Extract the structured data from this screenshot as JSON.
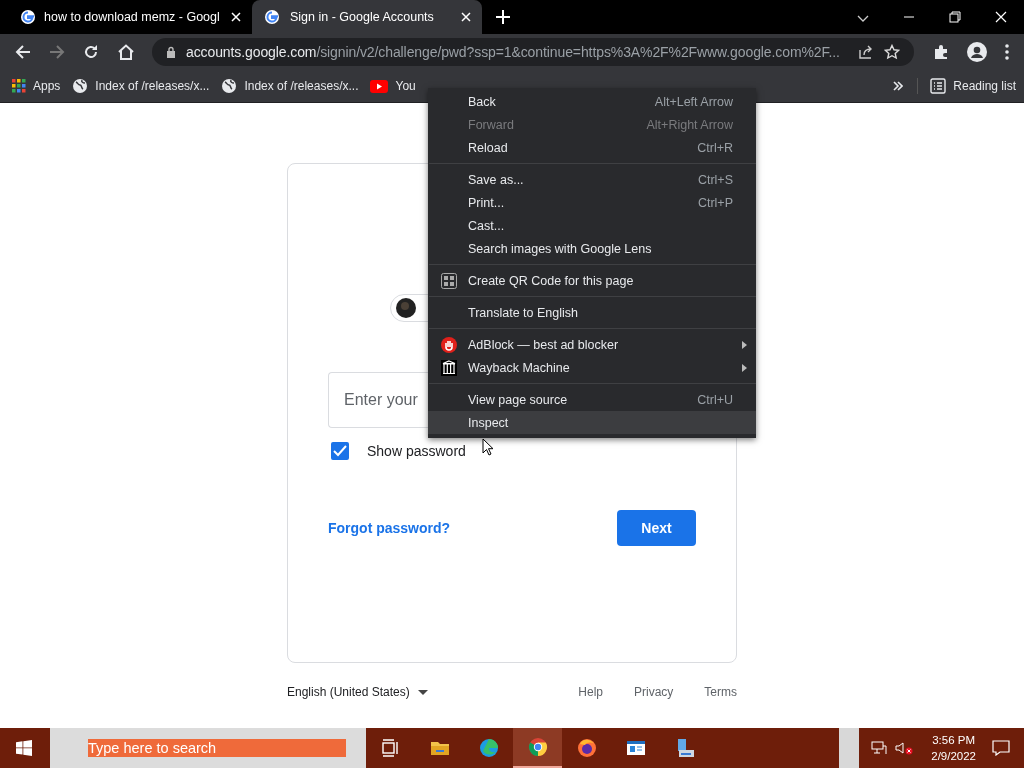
{
  "tabs": [
    {
      "title": "how to download memz - Googl",
      "selected": false
    },
    {
      "title": "Sign in - Google Accounts",
      "selected": true
    }
  ],
  "address": {
    "host": "accounts.google.com",
    "path": "/signin/v2/challenge/pwd?ssp=1&continue=https%3A%2F%2Fwww.google.com%2F..."
  },
  "bookmarks": [
    {
      "kind": "apps",
      "label": "Apps"
    },
    {
      "kind": "globe",
      "label": "Index of /releases/x..."
    },
    {
      "kind": "globe",
      "label": "Index of /releases/x..."
    },
    {
      "kind": "youtube",
      "label": "You"
    }
  ],
  "reading_list": "Reading list",
  "signin": {
    "password_placeholder": "Enter your",
    "show_password": {
      "label": "Show password",
      "checked": true
    },
    "forgot": "Forgot password?",
    "next": "Next"
  },
  "footer": {
    "language": "English (United States)",
    "links": [
      "Help",
      "Privacy",
      "Terms"
    ]
  },
  "context_menu": {
    "groups": [
      [
        {
          "label": "Back",
          "shortcut": "Alt+Left Arrow",
          "disabled": false,
          "selected": false
        },
        {
          "label": "Forward",
          "shortcut": "Alt+Right Arrow",
          "disabled": true,
          "selected": false
        },
        {
          "label": "Reload",
          "shortcut": "Ctrl+R",
          "disabled": false,
          "selected": false
        }
      ],
      [
        {
          "label": "Save as...",
          "shortcut": "Ctrl+S",
          "disabled": false,
          "selected": false
        },
        {
          "label": "Print...",
          "shortcut": "Ctrl+P",
          "disabled": false,
          "selected": false
        },
        {
          "label": "Cast...",
          "disabled": false,
          "selected": false
        },
        {
          "label": "Search images with Google Lens",
          "disabled": false,
          "selected": false
        }
      ],
      [
        {
          "label": "Create QR Code for this page",
          "kind": "qr",
          "disabled": false,
          "selected": false
        }
      ],
      [
        {
          "label": "Translate to English",
          "disabled": false,
          "selected": false
        }
      ],
      [
        {
          "label": "AdBlock — best ad blocker",
          "kind": "adblock",
          "submenu": true,
          "disabled": false,
          "selected": false
        },
        {
          "label": "Wayback Machine",
          "kind": "wayback",
          "submenu": true,
          "disabled": false,
          "selected": false
        }
      ],
      [
        {
          "label": "View page source",
          "shortcut": "Ctrl+U",
          "disabled": false,
          "selected": false
        },
        {
          "label": "Inspect",
          "disabled": false,
          "selected": true
        }
      ]
    ]
  },
  "taskbar": {
    "search_placeholder": "Type here to search",
    "apps": [
      {
        "kind": "taskview",
        "active": false
      },
      {
        "kind": "folder",
        "active": false
      },
      {
        "kind": "edge",
        "active": false
      },
      {
        "kind": "chrome",
        "active": true
      },
      {
        "kind": "firefox",
        "active": false
      },
      {
        "kind": "window",
        "active": false
      },
      {
        "kind": "network",
        "active": false
      }
    ],
    "time": "3:56 PM",
    "date": "2/9/2022"
  }
}
